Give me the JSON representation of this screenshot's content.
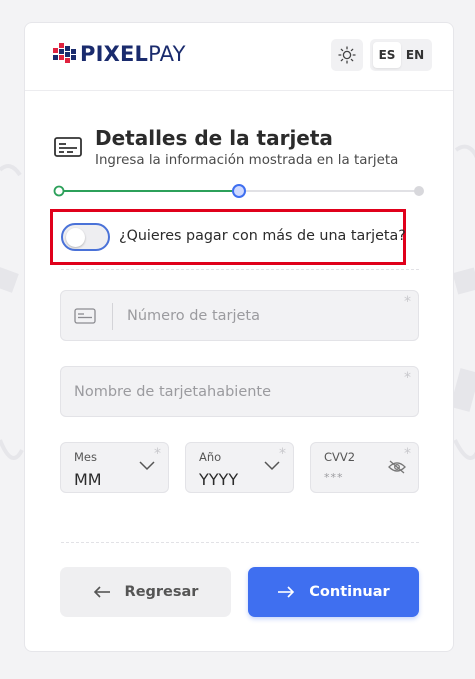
{
  "brand": {
    "bold": "PIXEL",
    "light": "PAY"
  },
  "header": {
    "languages": [
      {
        "code": "ES",
        "active": true
      },
      {
        "code": "EN",
        "active": false
      }
    ]
  },
  "section": {
    "title": "Detalles de la tarjeta",
    "subtitle": "Ingresa la información mostrada en la tarjeta"
  },
  "stepper": {
    "steps": 3,
    "current_step": 2
  },
  "multi_card": {
    "label": "¿Quieres pagar con más de una tarjeta?",
    "enabled": false
  },
  "form": {
    "card_number": {
      "placeholder": "Número de tarjeta",
      "required_mark": "*"
    },
    "cardholder": {
      "placeholder": "Nombre de tarjetahabiente",
      "required_mark": "*"
    },
    "month": {
      "label": "Mes",
      "value": "MM",
      "required_mark": "*"
    },
    "year": {
      "label": "Año",
      "value": "YYYY",
      "required_mark": "*"
    },
    "cvv": {
      "label": "CVV2",
      "placeholder": "***",
      "required_mark": "*"
    }
  },
  "actions": {
    "back_label": "Regresar",
    "continue_label": "Continuar"
  },
  "colors": {
    "accent": "#3f6ff0",
    "step_done": "#2ca05a",
    "highlight": "#e0001b",
    "brand_navy": "#1a2b6d",
    "brand_red": "#e0233f"
  }
}
